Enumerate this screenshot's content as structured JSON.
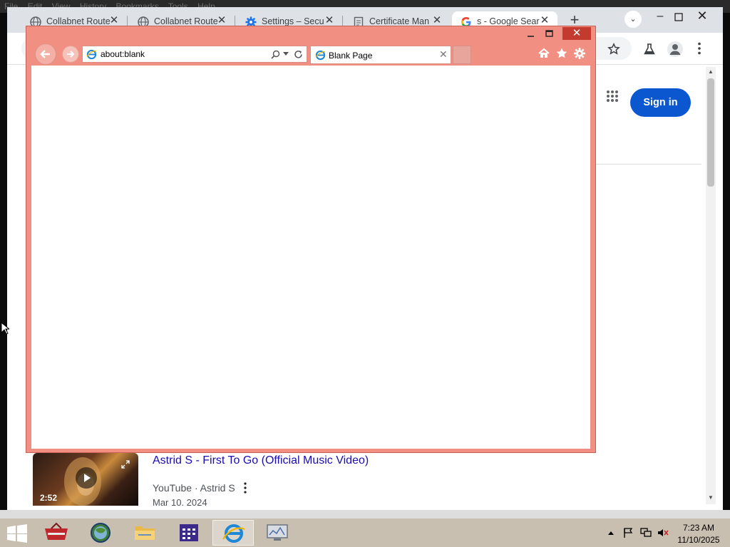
{
  "background_menubar": {
    "items": [
      "File",
      "Edit",
      "View",
      "History",
      "Bookmarks",
      "Tools",
      "Help"
    ]
  },
  "chrome": {
    "tabs": [
      {
        "label": "Collabnet Route",
        "icon": "globe-icon"
      },
      {
        "label": "Collabnet Route",
        "icon": "globe-icon"
      },
      {
        "label": "Settings – Secu",
        "icon": "gear-icon"
      },
      {
        "label": "Certificate Man",
        "icon": "document-icon"
      },
      {
        "label": "s - Google Sear",
        "icon": "google-icon",
        "active": true
      }
    ],
    "new_tab_label": "+",
    "sign_in_label": "Sign in",
    "accent_color": "#0b57d0"
  },
  "search_result": {
    "title": "Astrid S - First To Go (Official Music Video)",
    "source": "YouTube · Astrid S",
    "date": "Mar 10, 2024",
    "duration": "2:52"
  },
  "ie": {
    "address": "about:blank",
    "tab_label": "Blank Page",
    "frame_color": "#f08f82"
  },
  "taskbar": {
    "apps": [
      "toolbox-icon",
      "globe-browser-icon",
      "file-explorer-icon",
      "calendar-app-icon",
      "internet-explorer-icon",
      "monitor-app-icon"
    ],
    "time": "7:23 AM",
    "date": "11/10/2025"
  }
}
